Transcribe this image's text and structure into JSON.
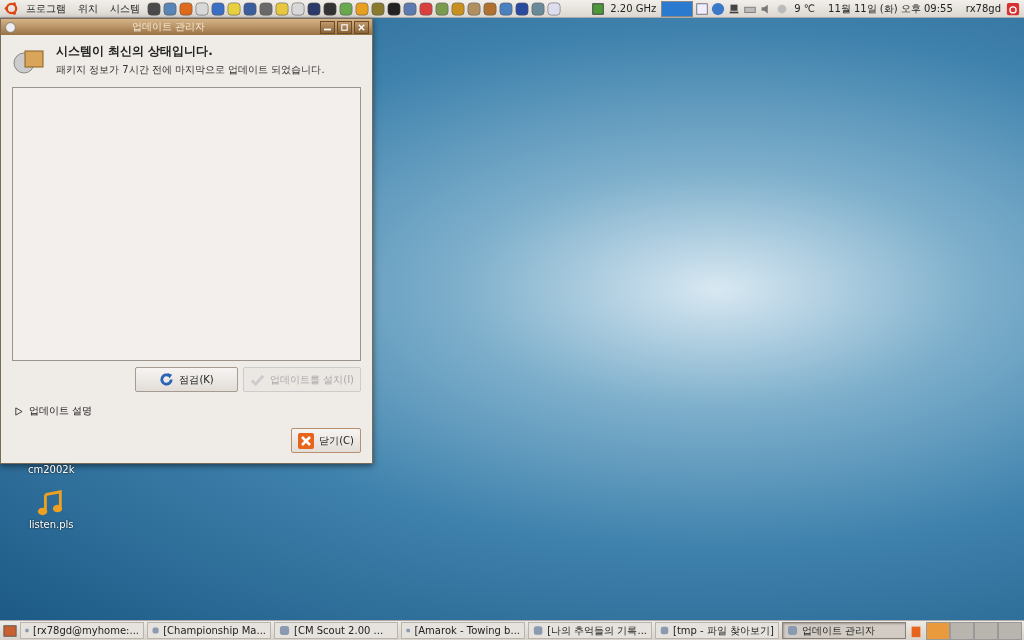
{
  "top_panel": {
    "menus": [
      "프로그램",
      "위치",
      "시스템"
    ],
    "cpu_frequency": "2.20 GHz",
    "temperature": "9 ℃",
    "clock": "11월 11일 (화) 오후 09:55",
    "user": "rx78gd"
  },
  "window": {
    "title": "업데이트 관리자",
    "heading": "시스템이 최신의 상태입니다.",
    "subtitle": "패키지 정보가 7시간 전에 마지막으로 업데이트 되었습니다.",
    "buttons": [
      {
        "label": "점검(K)",
        "kind": "check",
        "disabled": false
      },
      {
        "label": "업데이트를 설치(I)",
        "kind": "install",
        "disabled": true
      }
    ],
    "expander": {
      "label": "업데이트 설명",
      "expanded": false
    },
    "close_button": "닫기(C)"
  },
  "desktop_icons": [
    {
      "label": "cm2002k",
      "kind": "hidden"
    },
    {
      "label": "listen.pls",
      "kind": "music"
    }
  ],
  "taskbar": {
    "items": [
      {
        "label": "[rx78gd@myhome:...",
        "selected": false
      },
      {
        "label": "[Championship Ma...",
        "selected": false
      },
      {
        "label": "[CM Scout 2.00 ...",
        "selected": false
      },
      {
        "label": "[Amarok - Towing b...",
        "selected": false
      },
      {
        "label": "[나의 추억들의 기록...",
        "selected": false
      },
      {
        "label": "[tmp - 파일 찾아보기]",
        "selected": false
      },
      {
        "label": "업데이트 관리자",
        "selected": true
      }
    ],
    "workspaces": [
      {
        "selected": true
      },
      {
        "selected": false
      },
      {
        "selected": false
      },
      {
        "selected": false
      }
    ]
  }
}
